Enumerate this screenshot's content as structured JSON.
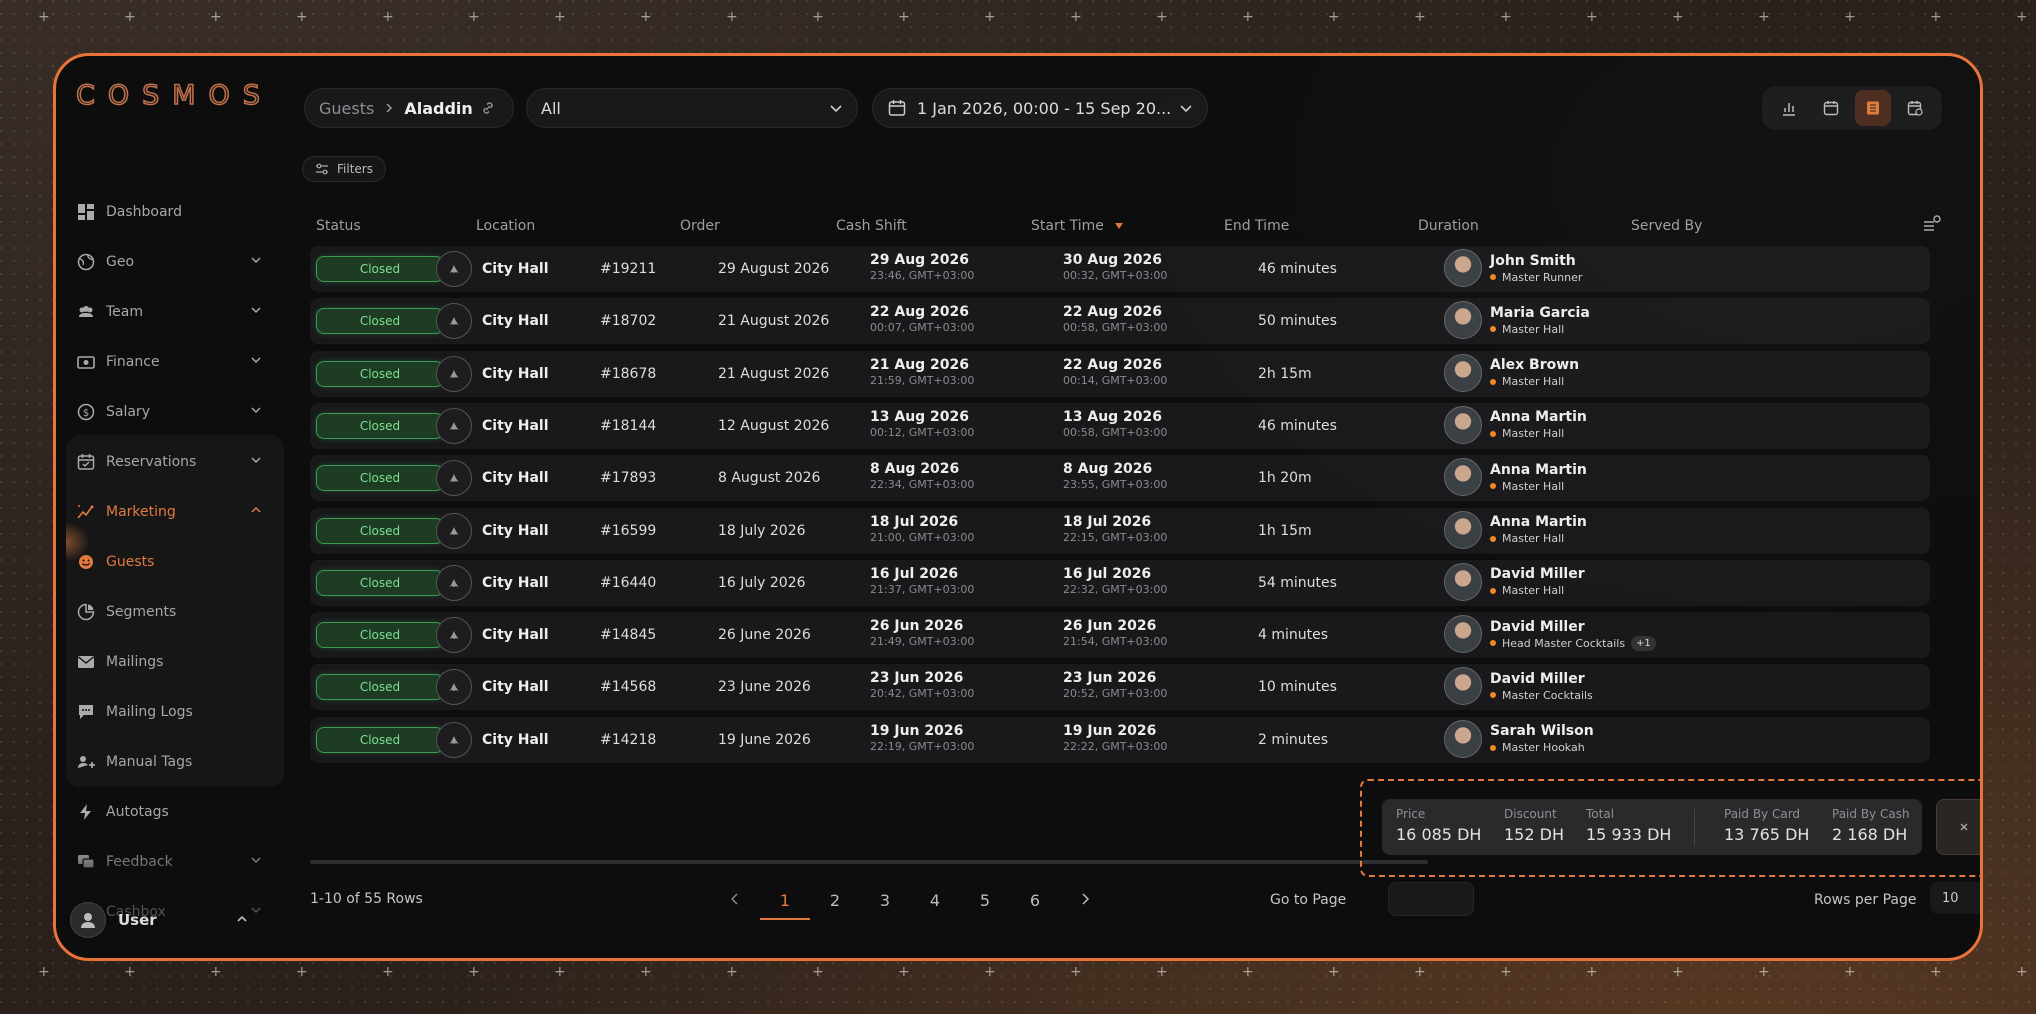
{
  "brand": {
    "logo": "COSMOS"
  },
  "sidebar": {
    "items": [
      {
        "label": "Dashboard",
        "icon": "dashboard-icon",
        "has_chevron": false
      },
      {
        "label": "Geo",
        "icon": "globe-icon",
        "has_chevron": true
      },
      {
        "label": "Team",
        "icon": "team-icon",
        "has_chevron": true
      },
      {
        "label": "Finance",
        "icon": "finance-icon",
        "has_chevron": true
      },
      {
        "label": "Salary",
        "icon": "salary-icon",
        "has_chevron": true
      },
      {
        "label": "Reservations",
        "icon": "reservations-icon",
        "has_chevron": true
      },
      {
        "label": "Marketing",
        "icon": "marketing-icon",
        "has_chevron": true,
        "expanded": true
      },
      {
        "label": "Guests",
        "icon": "guests-icon",
        "has_chevron": false,
        "active": true
      },
      {
        "label": "Segments",
        "icon": "segments-icon",
        "has_chevron": false
      },
      {
        "label": "Mailings",
        "icon": "mail-icon",
        "has_chevron": false
      },
      {
        "label": "Mailing Logs",
        "icon": "mailing-logs-icon",
        "has_chevron": false
      },
      {
        "label": "Manual Tags",
        "icon": "tags-icon",
        "has_chevron": false
      },
      {
        "label": "Autotags",
        "icon": "bolt-icon",
        "has_chevron": false
      },
      {
        "label": "Feedback",
        "icon": "feedback-icon",
        "has_chevron": true
      },
      {
        "label": "Cashbox",
        "icon": "cashbox-icon",
        "has_chevron": true
      }
    ],
    "user": {
      "name": "User"
    }
  },
  "header": {
    "breadcrumb": {
      "parent": "Guests",
      "current": "Aladdin"
    },
    "select": {
      "value": "All"
    },
    "date_range": {
      "value": "1 Jan 2026, 00:00 - 15 Sep 20..."
    },
    "filters_label": "Filters"
  },
  "accent": "#e07a3f",
  "table": {
    "columns": [
      "Status",
      "Location",
      "Order",
      "Cash Shift",
      "Start Time",
      "End Time",
      "Duration",
      "Served By"
    ],
    "rows": [
      {
        "status": "Closed",
        "location": "City Hall",
        "order": "#19211",
        "shift": "29 August 2026",
        "start_d": "29 Aug 2026",
        "start_s": "23:46, GMT+03:00",
        "end_d": "30 Aug 2026",
        "end_s": "00:32, GMT+03:00",
        "duration": "46 minutes",
        "name": "John Smith",
        "role": "Master Runner",
        "extra": ""
      },
      {
        "status": "Closed",
        "location": "City Hall",
        "order": "#18702",
        "shift": "21 August 2026",
        "start_d": "22 Aug 2026",
        "start_s": "00:07, GMT+03:00",
        "end_d": "22 Aug 2026",
        "end_s": "00:58, GMT+03:00",
        "duration": "50 minutes",
        "name": "Maria Garcia",
        "role": "Master Hall",
        "extra": ""
      },
      {
        "status": "Closed",
        "location": "City Hall",
        "order": "#18678",
        "shift": "21 August 2026",
        "start_d": "21 Aug 2026",
        "start_s": "21:59, GMT+03:00",
        "end_d": "22 Aug 2026",
        "end_s": "00:14, GMT+03:00",
        "duration": "2h 15m",
        "name": "Alex Brown",
        "role": "Master Hall",
        "extra": ""
      },
      {
        "status": "Closed",
        "location": "City Hall",
        "order": "#18144",
        "shift": "12 August 2026",
        "start_d": "13 Aug 2026",
        "start_s": "00:12, GMT+03:00",
        "end_d": "13 Aug 2026",
        "end_s": "00:58, GMT+03:00",
        "duration": "46 minutes",
        "name": "Anna Martin",
        "role": "Master Hall",
        "extra": ""
      },
      {
        "status": "Closed",
        "location": "City Hall",
        "order": "#17893",
        "shift": "8 August 2026",
        "start_d": "8 Aug 2026",
        "start_s": "22:34, GMT+03:00",
        "end_d": "8 Aug 2026",
        "end_s": "23:55, GMT+03:00",
        "duration": "1h 20m",
        "name": "Anna Martin",
        "role": "Master Hall",
        "extra": ""
      },
      {
        "status": "Closed",
        "location": "City Hall",
        "order": "#16599",
        "shift": "18 July 2026",
        "start_d": "18 Jul 2026",
        "start_s": "21:00, GMT+03:00",
        "end_d": "18 Jul 2026",
        "end_s": "22:15, GMT+03:00",
        "duration": "1h 15m",
        "name": "Anna Martin",
        "role": "Master Hall",
        "extra": ""
      },
      {
        "status": "Closed",
        "location": "City Hall",
        "order": "#16440",
        "shift": "16 July 2026",
        "start_d": "16 Jul 2026",
        "start_s": "21:37, GMT+03:00",
        "end_d": "16 Jul 2026",
        "end_s": "22:32, GMT+03:00",
        "duration": "54 minutes",
        "name": "David Miller",
        "role": "Master Hall",
        "extra": ""
      },
      {
        "status": "Closed",
        "location": "City Hall",
        "order": "#14845",
        "shift": "26 June 2026",
        "start_d": "26 Jun 2026",
        "start_s": "21:49, GMT+03:00",
        "end_d": "26 Jun 2026",
        "end_s": "21:54, GMT+03:00",
        "duration": "4 minutes",
        "name": "David Miller",
        "role": "Head Master Cocktails",
        "extra": "+1"
      },
      {
        "status": "Closed",
        "location": "City Hall",
        "order": "#14568",
        "shift": "23 June 2026",
        "start_d": "23 Jun 2026",
        "start_s": "20:42, GMT+03:00",
        "end_d": "23 Jun 2026",
        "end_s": "20:52, GMT+03:00",
        "duration": "10 minutes",
        "name": "David Miller",
        "role": "Master Cocktails",
        "extra": ""
      },
      {
        "status": "Closed",
        "location": "City Hall",
        "order": "#14218",
        "shift": "19 June 2026",
        "start_d": "19 Jun 2026",
        "start_s": "22:19, GMT+03:00",
        "end_d": "19 Jun 2026",
        "end_s": "22:22, GMT+03:00",
        "duration": "2 minutes",
        "name": "Sarah Wilson",
        "role": "Master Hookah",
        "extra": ""
      }
    ]
  },
  "summary": {
    "price_label": "Price",
    "price": "16 085 DH",
    "discount_label": "Discount",
    "discount": "152 DH",
    "total_label": "Total",
    "total": "15 933 DH",
    "card_label": "Paid By Card",
    "card": "13 765 DH",
    "cash_label": "Paid By Cash",
    "cash": "2 168 DH"
  },
  "footer": {
    "rows_info": "1-10 of 55 Rows",
    "pages": [
      "1",
      "2",
      "3",
      "4",
      "5",
      "6"
    ],
    "current_page": "1",
    "goto_label": "Go to Page",
    "rpp_label": "Rows per Page",
    "rpp_value": "10"
  }
}
